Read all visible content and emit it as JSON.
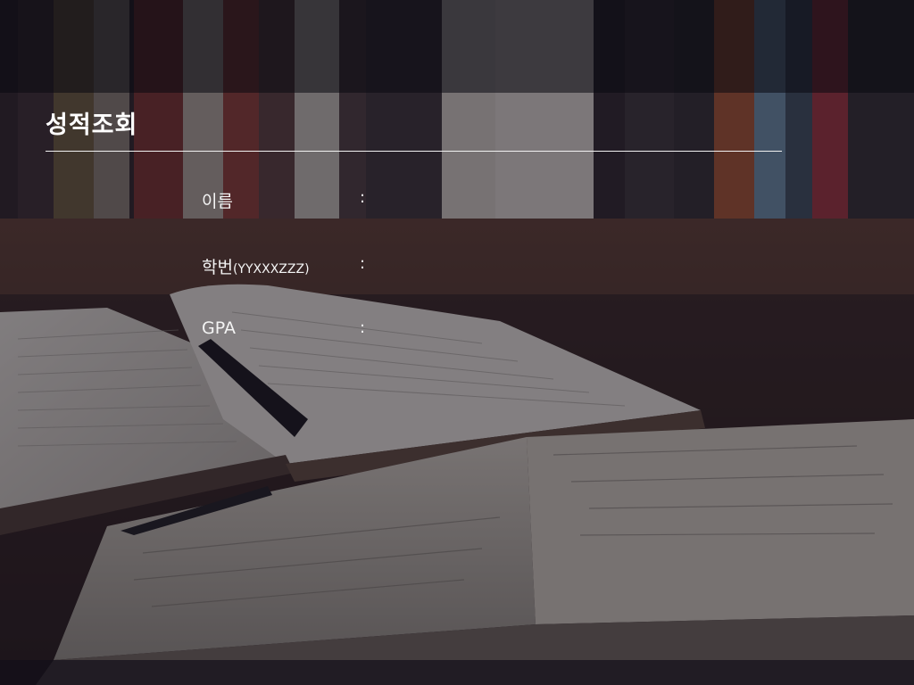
{
  "page": {
    "title": "성적조회"
  },
  "fields": [
    {
      "label": "이름",
      "label_sub": "",
      "colon": ":",
      "value": ""
    },
    {
      "label": "학번",
      "label_sub": "(YYXXXZZZ)",
      "colon": ":",
      "value": ""
    },
    {
      "label": "GPA",
      "label_sub": "",
      "colon": ":",
      "value": ""
    }
  ],
  "theme": {
    "text_color": "#ffffff",
    "rule_color": "#f2f2f2",
    "overlay_color": "#16142270"
  }
}
